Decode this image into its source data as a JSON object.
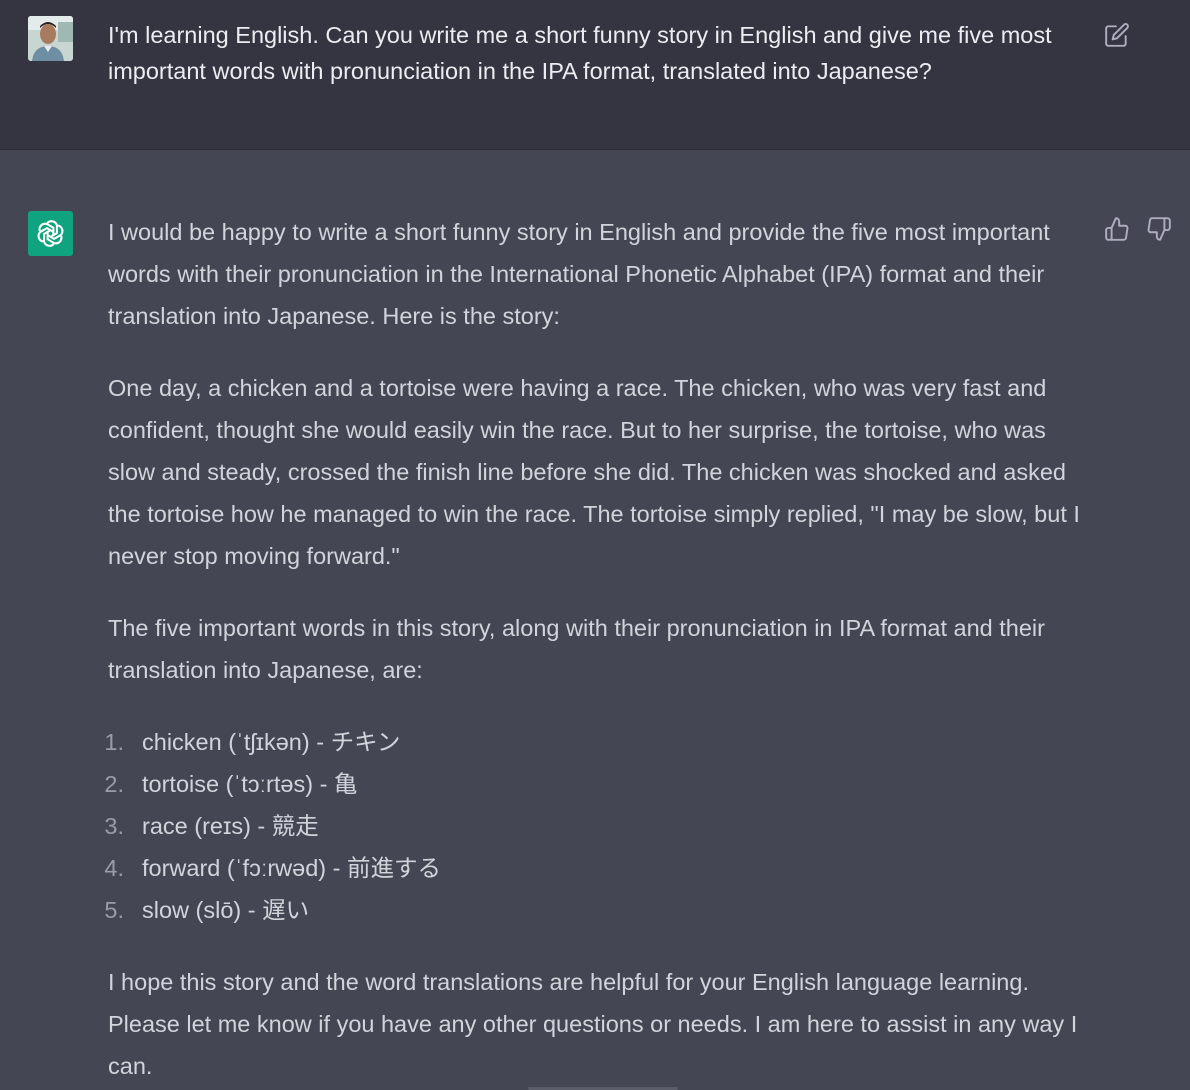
{
  "user_message": {
    "avatar": "user-photo-avatar",
    "text": "I'm learning English. Can you write me a short funny story in English and give me five most important words with pronunciation in the IPA format, translated into Japanese?",
    "edit_icon": "edit-icon"
  },
  "assistant_message": {
    "avatar": "openai-logo-icon",
    "intro": "I would be happy to write a short funny story in English and provide the five most important words with their pronunciation in the International Phonetic Alphabet (IPA) format and their translation into Japanese. Here is the story:",
    "story": "One day, a chicken and a tortoise were having a race. The chicken, who was very fast and confident, thought she would easily win the race. But to her surprise, the tortoise, who was slow and steady, crossed the finish line before she did. The chicken was shocked and asked the tortoise how he managed to win the race. The tortoise simply replied, \"I may be slow, but I never stop moving forward.\"",
    "list_intro": "The five important words in this story, along with their pronunciation in IPA format and their translation into Japanese, are:",
    "words": [
      {
        "num": "1.",
        "text": "chicken (ˈtʃɪkən) - チキン"
      },
      {
        "num": "2.",
        "text": "tortoise (ˈtɔːrtəs) - 亀"
      },
      {
        "num": "3.",
        "text": "race (reɪs) - 競走"
      },
      {
        "num": "4.",
        "text": "forward (ˈfɔːrwəd) - 前進する"
      },
      {
        "num": "5.",
        "text": "slow (slō) - 遅い"
      }
    ],
    "closing": "I hope this story and the word translations are helpful for your English language learning. Please let me know if you have any other questions or needs. I am here to assist in any way I can.",
    "icons": [
      "thumbs-up-icon",
      "thumbs-down-icon"
    ]
  },
  "colors": {
    "user_bg": "#343541",
    "assistant_bg": "#444654",
    "accent": "#10a37f",
    "text": "#d1d5db"
  }
}
